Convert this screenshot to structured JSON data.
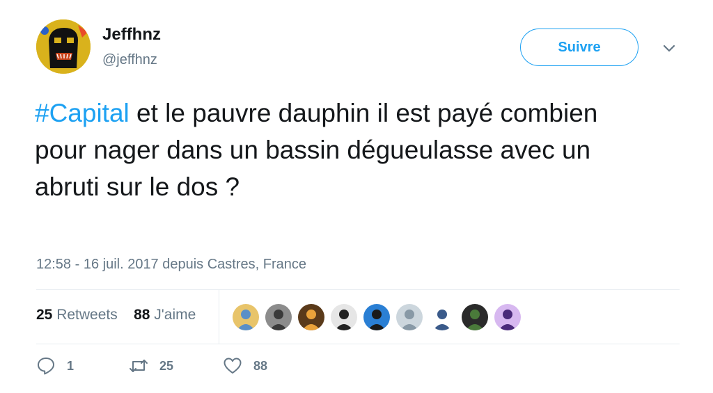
{
  "user": {
    "display_name": "Jeffhnz",
    "handle": "@jeffhnz",
    "avatar_icon": "abstract-face-avatar"
  },
  "follow_button": {
    "label": "Suivre"
  },
  "menu_icon": "chevron-down-icon",
  "tweet": {
    "hashtag": "#Capital",
    "text": " et le pauvre dauphin il est payé combien pour nager dans un bassin dégueulasse avec un abruti sur le dos ?"
  },
  "meta": {
    "timestamp": "12:58 - 16 juil. 2017 depuis Castres, France"
  },
  "stats": {
    "retweets_count": "25",
    "retweets_label": "Retweets",
    "likes_count": "88",
    "likes_label": "J'aime"
  },
  "likers": [
    {
      "colors": [
        "#e8c46a",
        "#5a8fc7"
      ]
    },
    {
      "colors": [
        "#8c8c8c",
        "#3a3a3a"
      ]
    },
    {
      "colors": [
        "#5a3a1a",
        "#e9a23b"
      ]
    },
    {
      "colors": [
        "#e6e6e6",
        "#222222"
      ]
    },
    {
      "colors": [
        "#2a7fd4",
        "#1a1a1a"
      ]
    },
    {
      "colors": [
        "#ccd6dd",
        "#8899a6"
      ]
    },
    {
      "colors": [
        "#ffffff",
        "#3a5a8a"
      ]
    },
    {
      "colors": [
        "#2a2a2a",
        "#4a7a3a"
      ]
    },
    {
      "colors": [
        "#d7b8f0",
        "#4a2a7a"
      ]
    }
  ],
  "actions": {
    "reply_count": "1",
    "retweet_count": "25",
    "like_count": "88"
  },
  "colors": {
    "accent": "#1da1f2",
    "secondary_text": "#657786",
    "divider": "#e6ecf0"
  }
}
